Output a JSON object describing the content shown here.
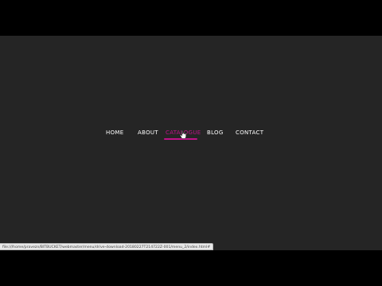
{
  "nav": {
    "items": [
      {
        "label": "HOME"
      },
      {
        "label": "ABOUT"
      },
      {
        "label": "CATALOGUE"
      },
      {
        "label": "BLOG"
      },
      {
        "label": "CONTACT"
      }
    ],
    "active_index": 2,
    "active_color": "#c0138a",
    "text_color": "#ffffff"
  },
  "page": {
    "background": "#252525",
    "letterbox": "#000000"
  },
  "status_bar": {
    "url": "file:///home/pravezn/BITBUCKET/webmaster/menu/drive-download-20180227T214722Z-001/menu_2/index.html#"
  },
  "cursor": {
    "icon": "pointer-cursor-icon"
  }
}
